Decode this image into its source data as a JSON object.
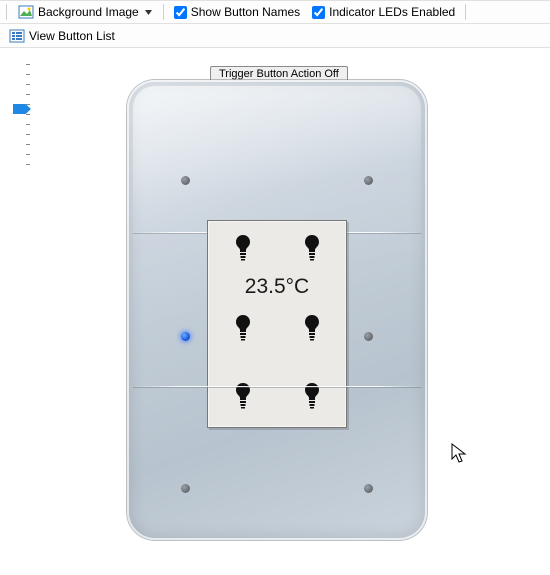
{
  "toolbar": {
    "background_image_label": "Background Image",
    "show_button_names_label": "Show Button Names",
    "show_button_names_checked": true,
    "indicator_leds_label": "Indicator LEDs Enabled",
    "indicator_leds_checked": true,
    "view_button_list_label": "View Button List"
  },
  "trigger_button_label": "Trigger Button Action Off",
  "device": {
    "temperature_display": "23.5°C",
    "leds": [
      {
        "id": "led-1",
        "on": false
      },
      {
        "id": "led-2",
        "on": false
      },
      {
        "id": "led-3",
        "on": true
      },
      {
        "id": "led-4",
        "on": false
      },
      {
        "id": "led-5",
        "on": false
      },
      {
        "id": "led-6",
        "on": false
      }
    ],
    "screen_icons": [
      "bulb",
      "bulb",
      "bulb",
      "bulb",
      "bulb",
      "bulb"
    ]
  },
  "slider": {
    "min": 0,
    "max": 10,
    "value": 4
  },
  "colors": {
    "led_on": "#1f5fe0",
    "led_off": "#6b7076",
    "panel": "#c8d2dc"
  }
}
